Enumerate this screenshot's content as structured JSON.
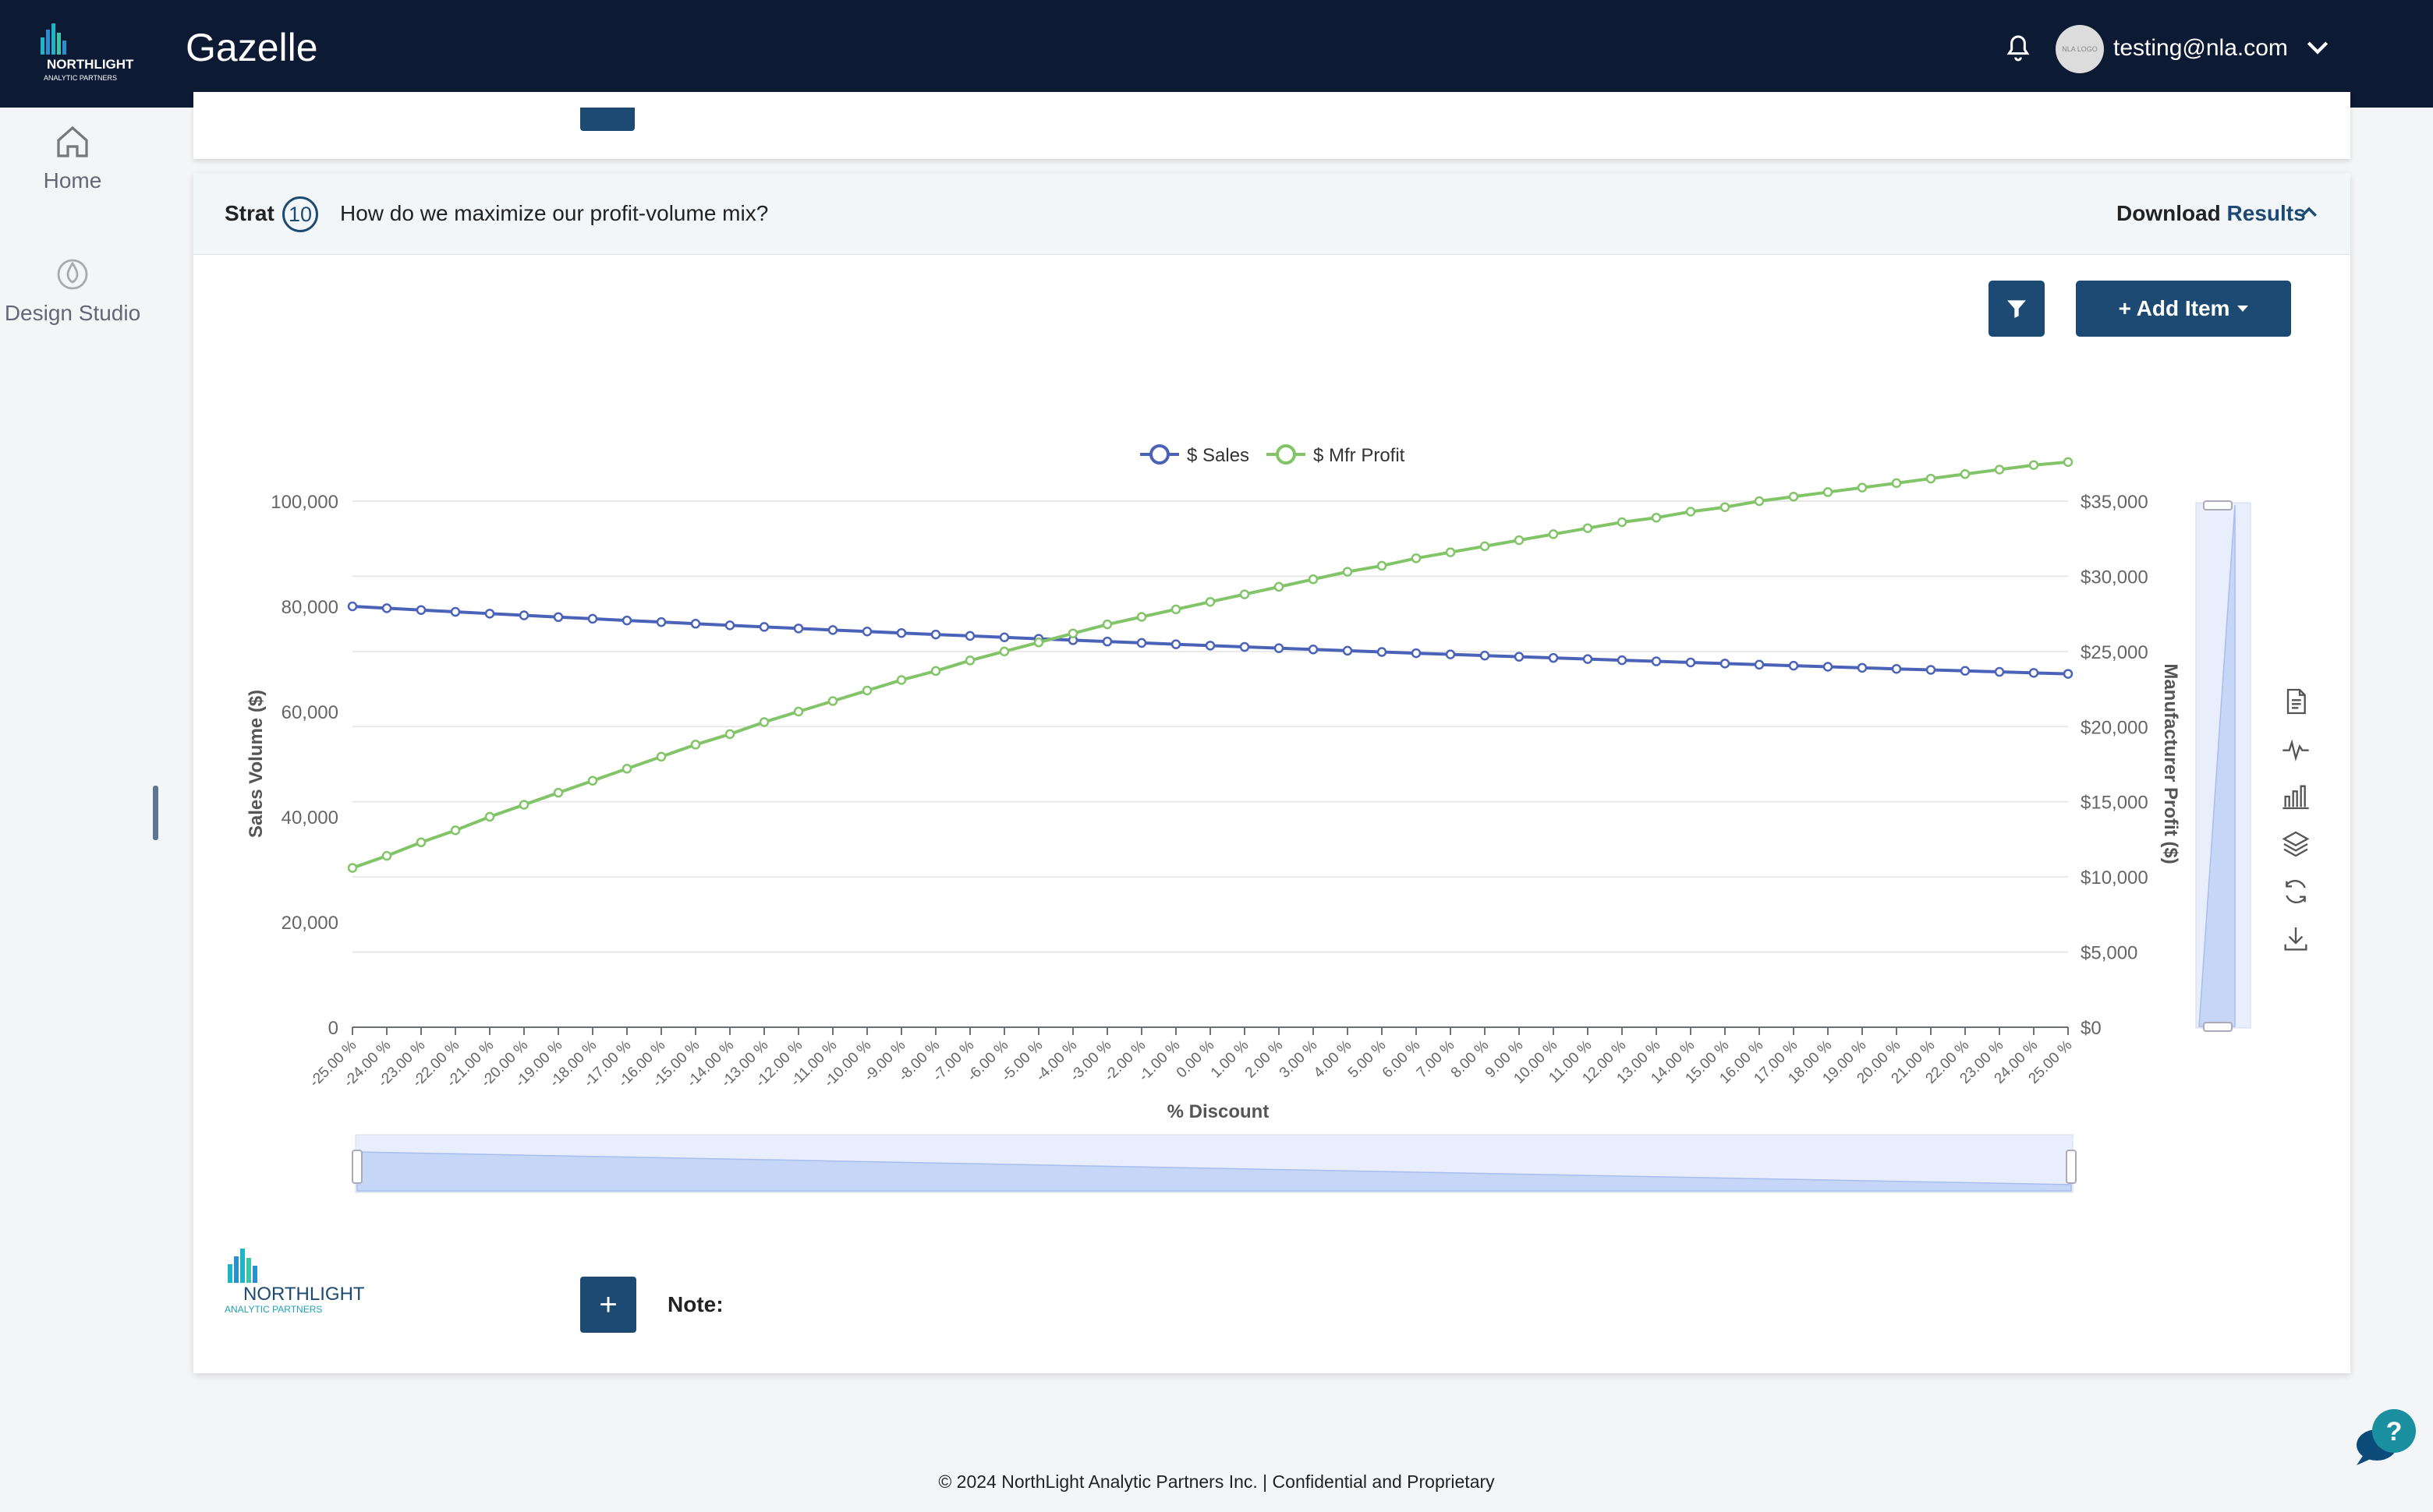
{
  "header": {
    "app_title": "Gazelle",
    "logo_text": "NORTHLIGHT",
    "logo_sub": "ANALYTIC PARTNERS",
    "avatar_text": "NLA LOGO",
    "user_email": "testing@nla.com",
    "icons": {
      "notifications": "bell-icon",
      "user_menu": "chevron-down-icon"
    }
  },
  "sidebar": {
    "items": [
      {
        "label": "Home",
        "icon": "home-icon"
      },
      {
        "label": "Design Studio",
        "icon": "design-studio-icon"
      }
    ]
  },
  "card": {
    "strat_label": "Strat",
    "strat_number": "10",
    "question": "How do we maximize our profit-volume mix?",
    "download_label": "Download",
    "results_label": "Results",
    "add_item_label": "+ Add Item"
  },
  "note": {
    "label": "Note:",
    "add_label": "+"
  },
  "footer": {
    "text": "© 2024 NorthLight Analytic Partners Inc. | Confidential and Proprietary"
  },
  "colors": {
    "navbar": "#0d1a33",
    "primary": "#1d4a72",
    "sales_line": "#4a63b8",
    "profit_line": "#82c468",
    "help": "#1a8fa0"
  },
  "chart_data": {
    "type": "line",
    "title": "",
    "xlabel": "% Discount",
    "ylabel": "Sales Volume ($)",
    "y2label": "Manufacturer Profit ($)",
    "legend": "top-center",
    "grid": true,
    "ylim": [
      0,
      100000
    ],
    "y2lim": [
      0,
      35000
    ],
    "y_ticks": [
      "0",
      "20,000",
      "40,000",
      "60,000",
      "80,000",
      "100,000"
    ],
    "y2_ticks": [
      "$0",
      "$5,000",
      "$10,000",
      "$15,000",
      "$20,000",
      "$25,000",
      "$30,000",
      "$35,000"
    ],
    "x": [
      "-25.00 %",
      "-24.00 %",
      "-23.00 %",
      "-22.00 %",
      "-21.00 %",
      "-20.00 %",
      "-19.00 %",
      "-18.00 %",
      "-17.00 %",
      "-16.00 %",
      "-15.00 %",
      "-14.00 %",
      "-13.00 %",
      "-12.00 %",
      "-11.00 %",
      "-10.00 %",
      "-9.00 %",
      "-8.00 %",
      "-7.00 %",
      "-6.00 %",
      "-5.00 %",
      "-4.00 %",
      "-3.00 %",
      "-2.00 %",
      "-1.00 %",
      "0.00 %",
      "1.00 %",
      "2.00 %",
      "3.00 %",
      "4.00 %",
      "5.00 %",
      "6.00 %",
      "7.00 %",
      "8.00 %",
      "9.00 %",
      "10.00 %",
      "11.00 %",
      "12.00 %",
      "13.00 %",
      "14.00 %",
      "15.00 %",
      "16.00 %",
      "17.00 %",
      "18.00 %",
      "19.00 %",
      "20.00 %",
      "21.00 %",
      "22.00 %",
      "23.00 %",
      "24.00 %",
      "25.00 %"
    ],
    "series": [
      {
        "name": "$ Sales",
        "axis": "left",
        "values": [
          80000,
          79650,
          79300,
          78960,
          78620,
          78290,
          77960,
          77640,
          77320,
          77010,
          76700,
          76390,
          76090,
          75800,
          75500,
          75220,
          74930,
          74650,
          74380,
          74110,
          73840,
          73570,
          73310,
          73050,
          72790,
          72540,
          72290,
          72050,
          71810,
          71570,
          71330,
          71100,
          70870,
          70640,
          70420,
          70200,
          69980,
          69760,
          69550,
          69340,
          69130,
          68920,
          68720,
          68520,
          68320,
          68120,
          67930,
          67740,
          67550,
          67360,
          67170
        ]
      },
      {
        "name": "$ Mfr Profit",
        "axis": "right",
        "values": [
          10600,
          11400,
          12300,
          13100,
          14000,
          14800,
          15600,
          16400,
          17200,
          18000,
          18800,
          19500,
          20300,
          21000,
          21700,
          22400,
          23100,
          23700,
          24400,
          25000,
          25600,
          26200,
          26800,
          27300,
          27800,
          28300,
          28800,
          29300,
          29800,
          30300,
          30700,
          31200,
          31600,
          32000,
          32400,
          32800,
          33200,
          33600,
          33900,
          34300,
          34600,
          35000,
          35300,
          35600,
          35900,
          36200,
          36500,
          36800,
          37100,
          37400,
          37600
        ]
      }
    ]
  }
}
